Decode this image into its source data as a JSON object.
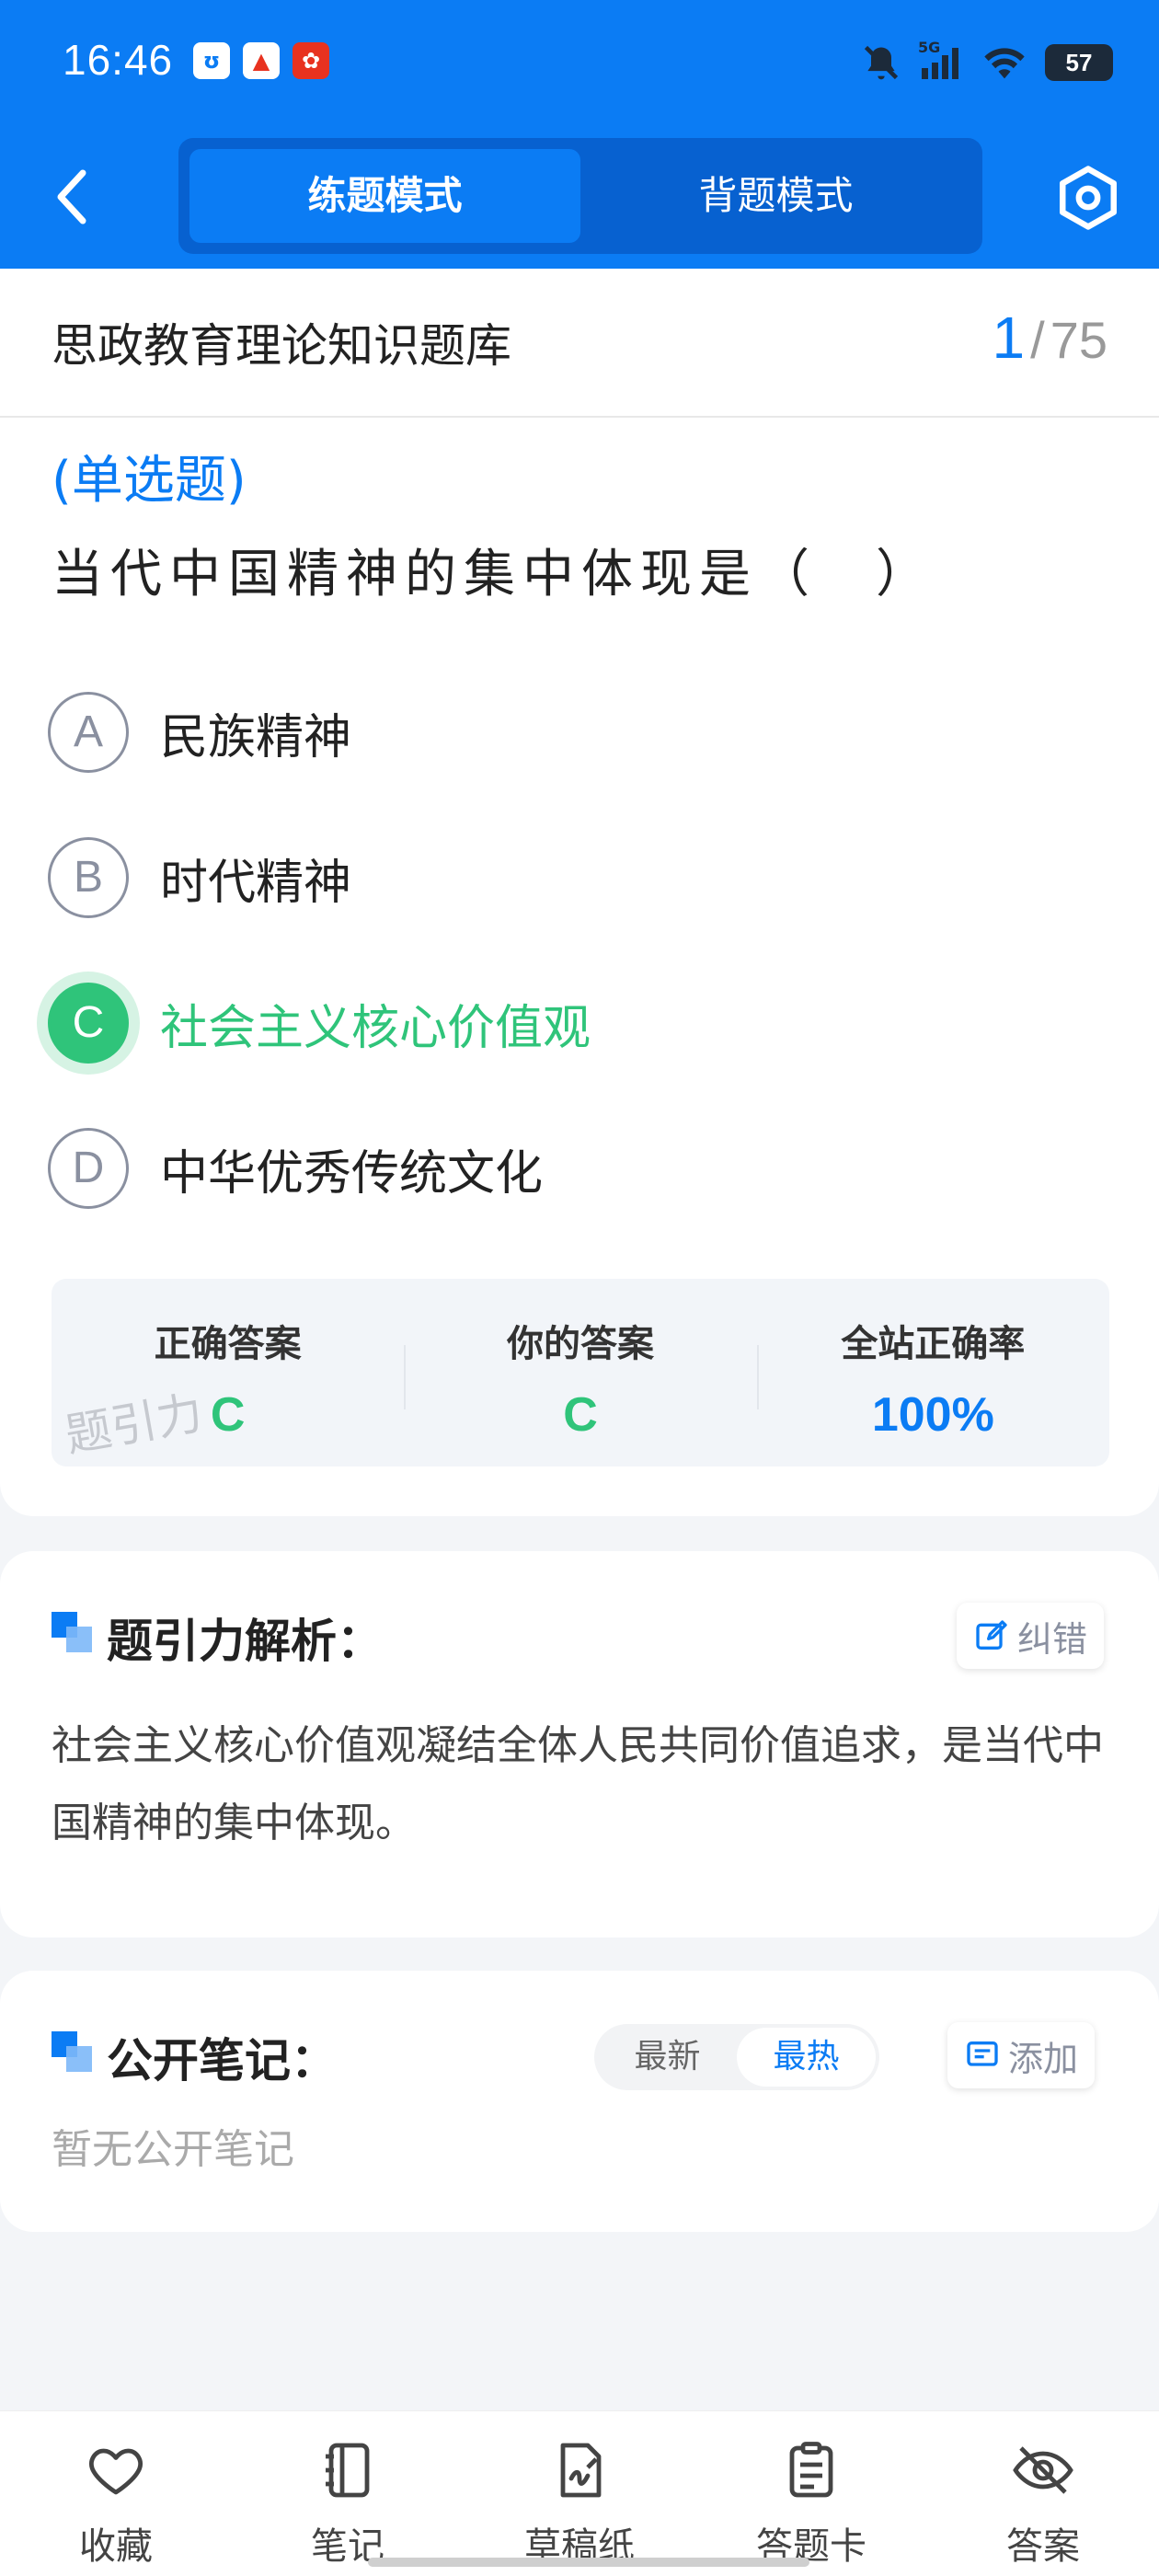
{
  "status_bar": {
    "time": "16:46",
    "network": "5G",
    "battery": "57"
  },
  "header": {
    "modes": [
      "练题模式",
      "背题模式"
    ],
    "active_mode": "练题模式"
  },
  "question_bank": {
    "title": "思政教育理论知识题库",
    "current": "1",
    "separator": "/",
    "total": "75"
  },
  "question": {
    "type": "(单选题)",
    "text": "当代中国精神的集中体现是（　）",
    "options": [
      {
        "letter": "A",
        "text": "民族精神"
      },
      {
        "letter": "B",
        "text": "时代精神"
      },
      {
        "letter": "C",
        "text": "社会主义核心价值观",
        "state": "correct"
      },
      {
        "letter": "D",
        "text": "中华优秀传统文化"
      }
    ]
  },
  "result": {
    "correct_label": "正确答案",
    "correct_value": "C",
    "yours_label": "你的答案",
    "yours_value": "C",
    "rate_label": "全站正确率",
    "rate_value": "100%",
    "watermark": "题引力"
  },
  "analysis": {
    "title": "题引力解析：",
    "report_button": "纠错",
    "text": "社会主义核心价值观凝结全体人民共同价值追求，是当代中国精神的集中体现。"
  },
  "notes": {
    "title": "公开笔记：",
    "sort_options": [
      "最新",
      "最热"
    ],
    "active_sort": "最热",
    "add_button": "添加",
    "empty_text": "暂无公开笔记"
  },
  "bottom_nav": [
    {
      "label": "收藏",
      "icon": "heart-icon"
    },
    {
      "label": "笔记",
      "icon": "notebook-icon"
    },
    {
      "label": "草稿纸",
      "icon": "draft-paper-icon"
    },
    {
      "label": "答题卡",
      "icon": "answer-sheet-icon"
    },
    {
      "label": "答案",
      "icon": "eye-off-icon"
    }
  ],
  "colors": {
    "brand": "#0b7cf4",
    "correct": "#2fc47a"
  }
}
